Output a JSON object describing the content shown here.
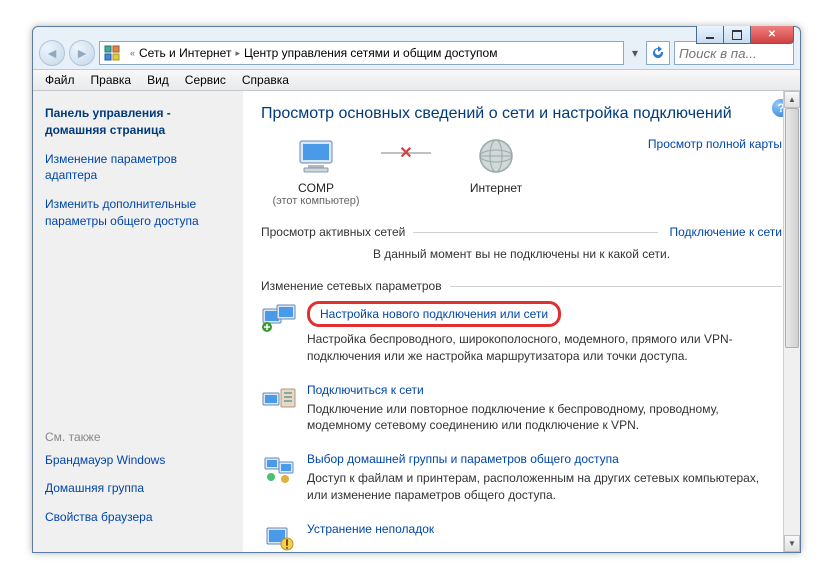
{
  "addr": {
    "crumb1": "Сеть и Интернет",
    "crumb2": "Центр управления сетями и общим доступом"
  },
  "search_placeholder": "Поиск в па...",
  "menubar": [
    "Файл",
    "Правка",
    "Вид",
    "Сервис",
    "Справка"
  ],
  "sidebar": {
    "home": "Панель управления - домашняя страница",
    "links": [
      "Изменение параметров адаптера",
      "Изменить дополнительные параметры общего доступа"
    ],
    "seealso_hdr": "См. также",
    "seealso": [
      "Брандмауэр Windows",
      "Домашняя группа",
      "Свойства браузера"
    ]
  },
  "content": {
    "title": "Просмотр основных сведений о сети и настройка подключений",
    "map": {
      "comp": "COMP",
      "comp_sub": "(этот компьютер)",
      "internet": "Интернет",
      "fullmap": "Просмотр полной карты"
    },
    "active": {
      "label": "Просмотр активных сетей",
      "link": "Подключение к сети",
      "text": "В данный момент вы не подключены ни к какой сети."
    },
    "change_hdr": "Изменение сетевых параметров",
    "tasks": [
      {
        "link": "Настройка нового подключения или сети",
        "desc": "Настройка беспроводного, широкополосного, модемного, прямого или VPN-подключения или же настройка маршрутизатора или точки доступа.",
        "hl": true
      },
      {
        "link": "Подключиться к сети",
        "desc": "Подключение или повторное подключение к беспроводному, проводному, модемному сетевому соединению или подключение к VPN.",
        "hl": false
      },
      {
        "link": "Выбор домашней группы и параметров общего доступа",
        "desc": "Доступ к файлам и принтерам, расположенным на других сетевых компьютерах, или изменение параметров общего доступа.",
        "hl": false
      },
      {
        "link": "Устранение неполадок",
        "desc": "",
        "hl": false
      }
    ]
  }
}
